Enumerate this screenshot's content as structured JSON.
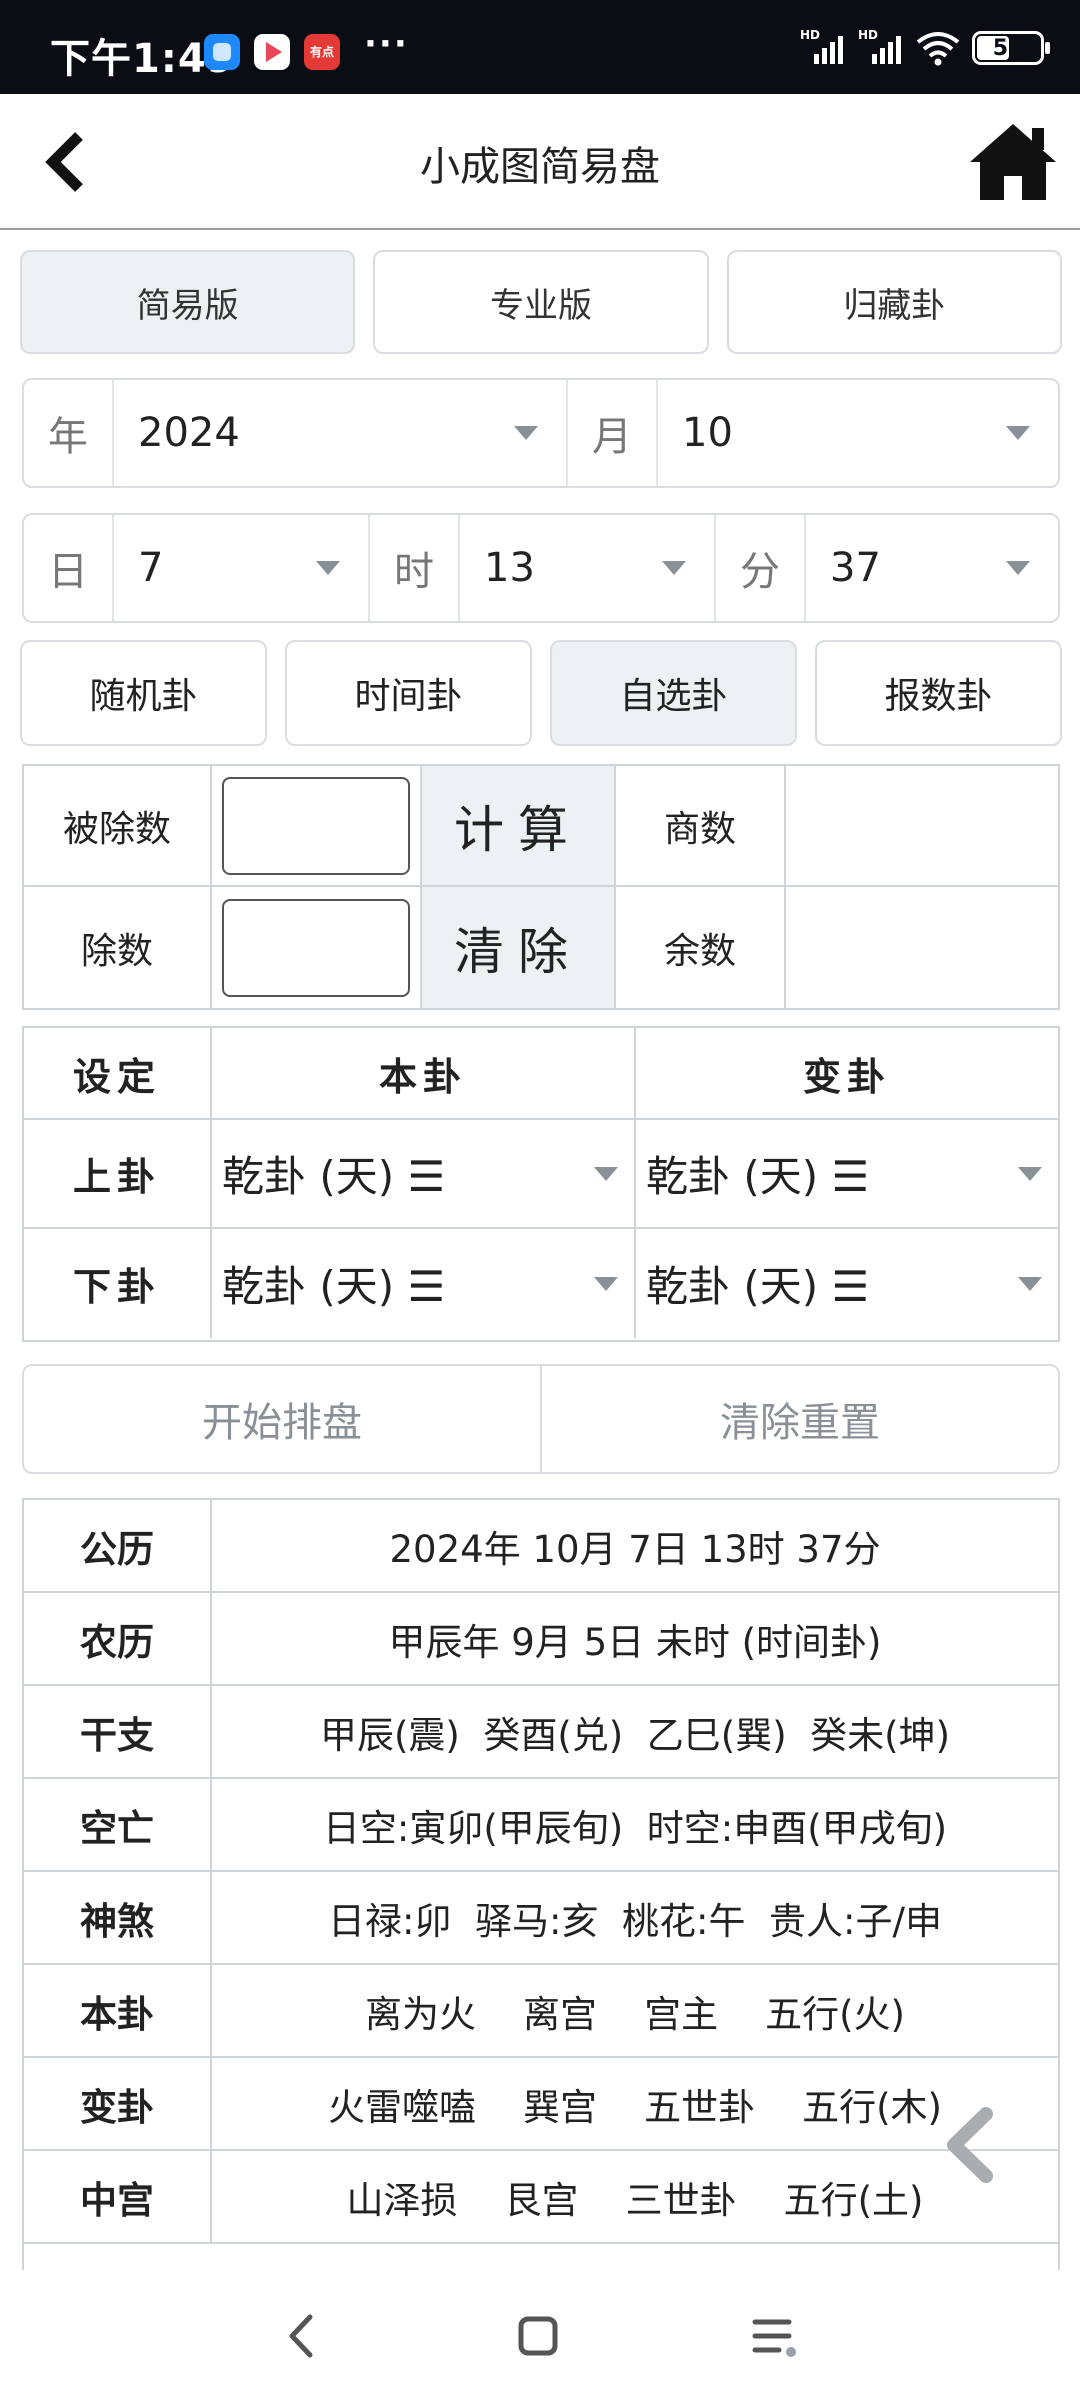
{
  "status_bar": {
    "time": "下午1:49",
    "app3_label": "有点",
    "more": "···",
    "signal1": "HD",
    "signal2": "HD",
    "battery": "52"
  },
  "header": {
    "title": "小成图简易盘"
  },
  "tabs": [
    {
      "label": "简易版",
      "active": true
    },
    {
      "label": "专业版",
      "active": false
    },
    {
      "label": "归藏卦",
      "active": false
    }
  ],
  "date": {
    "year_label": "年",
    "year_value": "2024",
    "month_label": "月",
    "month_value": "10",
    "day_label": "日",
    "day_value": "7",
    "hour_label": "时",
    "hour_value": "13",
    "minute_label": "分",
    "minute_value": "37"
  },
  "methods": [
    {
      "label": "随机卦",
      "active": false
    },
    {
      "label": "时间卦",
      "active": false
    },
    {
      "label": "自选卦",
      "active": true
    },
    {
      "label": "报数卦",
      "active": false
    }
  ],
  "calc": {
    "dividend_label": "被除数",
    "divisor_label": "除数",
    "compute_label": "计算",
    "clear_label": "清除",
    "quotient_label": "商数",
    "remainder_label": "余数",
    "quotient_value": "",
    "remainder_value": ""
  },
  "settings": {
    "col_setting": "设定",
    "col_ben": "本卦",
    "col_bian": "变卦",
    "upper_label": "上卦",
    "lower_label": "下卦",
    "upper_ben": "乾卦 (天) ☰",
    "upper_bian": "乾卦 (天) ☰",
    "lower_ben": "乾卦 (天) ☰",
    "lower_bian": "乾卦 (天) ☰"
  },
  "actions": {
    "start": "开始排盘",
    "reset": "清除重置"
  },
  "info": [
    {
      "key": "公历",
      "value": "2024年 10月 7日 13时 37分"
    },
    {
      "key": "农历",
      "value": "甲辰年 9月 5日 未时 (时间卦)"
    },
    {
      "key": "干支",
      "value": "甲辰(震)  癸酉(兑)  乙巳(巽)  癸未(坤)"
    },
    {
      "key": "空亡",
      "value": "日空:寅卯(甲辰旬)  时空:申酉(甲戌旬)"
    },
    {
      "key": "神煞",
      "value": "日禄:卯  驿马:亥  桃花:午  贵人:子/申"
    },
    {
      "key": "本卦",
      "value": "离为火    离宫    宫主    五行(火)"
    },
    {
      "key": "变卦",
      "value": "火雷噬嗑    巽宫    五世卦    五行(木)"
    },
    {
      "key": "中宫",
      "value": "山泽损    艮宫    三世卦    五行(土)"
    }
  ],
  "icons": {
    "back": "chevron-left-icon",
    "home": "home-icon",
    "float_back": "chevron-left-icon",
    "nav_back": "nav-back-icon",
    "nav_home": "nav-home-icon",
    "nav_menu": "nav-menu-icon"
  },
  "colors": {
    "status_bar_bg": "#0b0d14",
    "active_bg": "#eef1f3",
    "border": "#d9dde0",
    "muted_text": "#8a9097"
  }
}
